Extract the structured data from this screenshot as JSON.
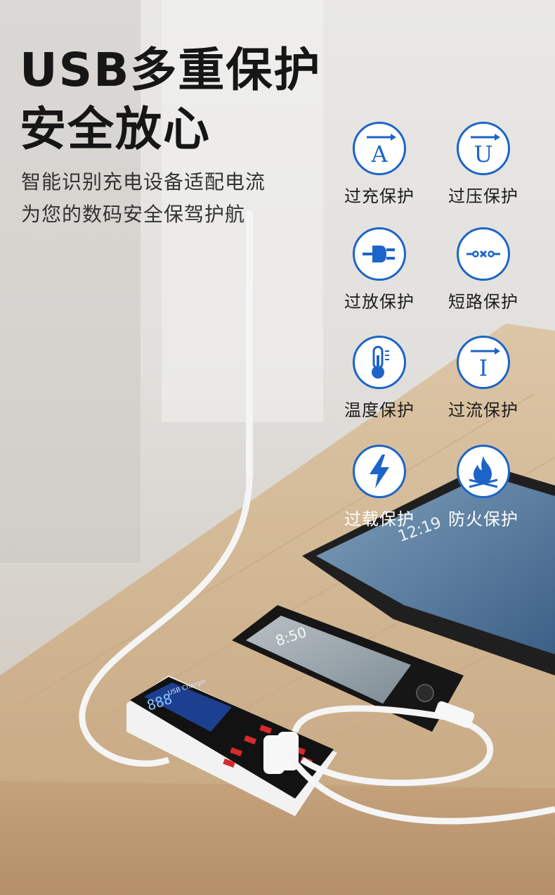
{
  "headline": {
    "line1": "USB多重保护",
    "line2": "安全放心"
  },
  "subtitle": {
    "line1": "智能识别充电设备适配电流",
    "line2": "为您的数码安全保驾护航"
  },
  "features": [
    {
      "label": "过充保护",
      "icon": "overcharge-icon",
      "letter": "A"
    },
    {
      "label": "过压保护",
      "icon": "overvoltage-icon",
      "letter": "U"
    },
    {
      "label": "过放保护",
      "icon": "plug-icon"
    },
    {
      "label": "短路保护",
      "icon": "short-circuit-icon"
    },
    {
      "label": "温度保护",
      "icon": "thermometer-icon"
    },
    {
      "label": "过流保护",
      "icon": "overcurrent-icon",
      "letter": "I"
    },
    {
      "label": "过载保护",
      "icon": "lightning-icon"
    },
    {
      "label": "防火保护",
      "icon": "flame-icon"
    }
  ],
  "devices": {
    "tablet_time": "12:19",
    "phone_time": "8:50",
    "charger_label": "USB Charger",
    "charger_display": "888"
  },
  "colors": {
    "accent": "#1d64c8",
    "headline": "#161616",
    "text": "#333333"
  }
}
